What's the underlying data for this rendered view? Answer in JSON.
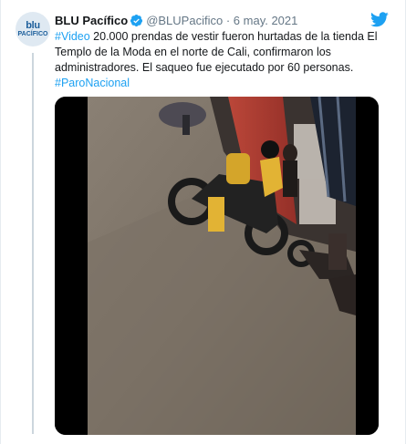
{
  "tweet": {
    "avatar": {
      "line1": "blu",
      "line2": "PACÍFICO",
      "color": "#1b5e9b"
    },
    "display_name": "BLU Pacífico",
    "handle": "@BLUPacifico",
    "separator": "·",
    "date": "6 may. 2021",
    "hashtag_video": "#Video",
    "body_text": " 20.000 prendas de vestir fueron hurtadas de la tienda El Templo de la Moda en el norte de Cali, confirmaron los administradores. El saqueo fue ejecutado por 60 personas.",
    "hashtag_paro": "#ParoNacional",
    "link_color": "#1da1f2",
    "brand_color": "#1da1f2"
  },
  "icons": {
    "verified": "verified-badge-icon",
    "logo": "twitter-bird-icon"
  }
}
